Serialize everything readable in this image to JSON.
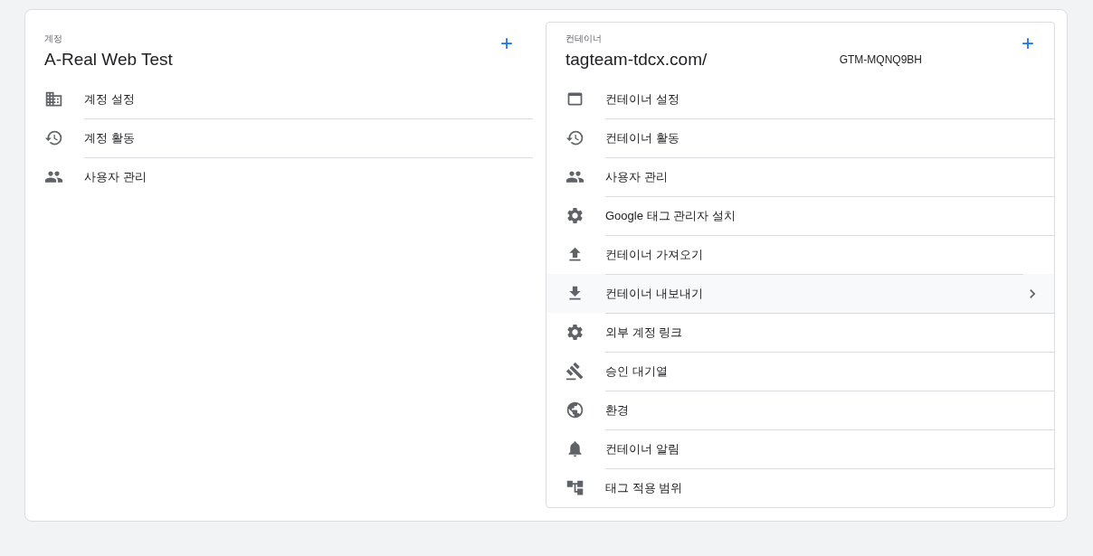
{
  "account": {
    "label": "계정",
    "title": "A-Real Web Test",
    "add_button": "+",
    "items": [
      {
        "kind": "building",
        "label": "계정 설정",
        "hovered": false
      },
      {
        "kind": "history",
        "label": "계정 활동",
        "hovered": false
      },
      {
        "kind": "people",
        "label": "사용자 관리",
        "hovered": false
      }
    ]
  },
  "container": {
    "label": "컨테이너",
    "title": "tagteam-tdcx.com/",
    "container_id": "GTM-MQNQ9BH",
    "add_button": "+",
    "items": [
      {
        "kind": "window",
        "label": "컨테이너 설정",
        "hovered": false
      },
      {
        "kind": "history",
        "label": "컨테이너 활동",
        "hovered": false
      },
      {
        "kind": "people",
        "label": "사용자 관리",
        "hovered": false
      },
      {
        "kind": "gear",
        "label": "Google 태그 관리자 설치",
        "hovered": false
      },
      {
        "kind": "upload",
        "label": "컨테이너 가져오기",
        "hovered": false
      },
      {
        "kind": "download",
        "label": "컨테이너 내보내기",
        "hovered": true
      },
      {
        "kind": "gear",
        "label": "외부 계정 링크",
        "hovered": false
      },
      {
        "kind": "gavel",
        "label": "승인 대기열",
        "hovered": false
      },
      {
        "kind": "globe",
        "label": "환경",
        "hovered": false
      },
      {
        "kind": "bell",
        "label": "컨테이너 알림",
        "hovered": false
      },
      {
        "kind": "tree",
        "label": "태그 적용 범위",
        "hovered": false
      }
    ]
  }
}
